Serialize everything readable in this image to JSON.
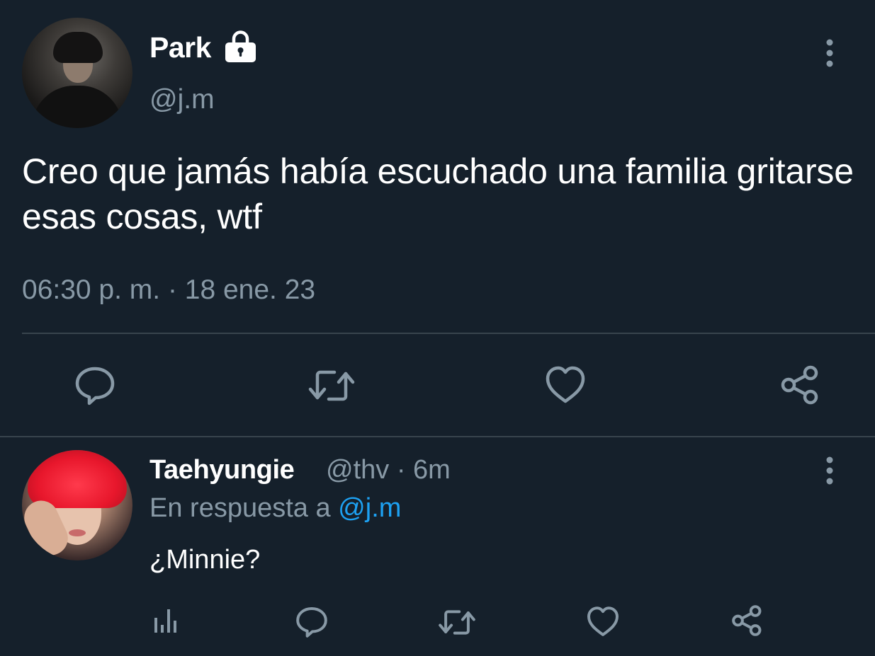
{
  "main_tweet": {
    "display_name": "Park",
    "handle": "@j.m",
    "text": "Creo que jamás había escuchado una familia gritarse esas cosas, wtf",
    "timestamp": "06:30 p. m. · 18 ene. 23",
    "icons": {
      "lock": "lock-icon",
      "more": "more-vertical-icon",
      "reply": "comment-icon",
      "retweet": "retweet-icon",
      "like": "heart-icon",
      "share": "share-icon"
    }
  },
  "reply": {
    "display_name": "Taehyungie",
    "handle_time": "@thv · 6m",
    "replying_prefix": "En respuesta a ",
    "replying_mention": "@j.m",
    "text": "¿Minnie?",
    "icons": {
      "analytics": "analytics-icon",
      "reply": "comment-icon",
      "retweet": "retweet-icon",
      "like": "heart-icon",
      "share": "share-icon",
      "more": "more-vertical-icon"
    }
  },
  "colors": {
    "background": "#15202b",
    "secondary_text": "#8899a6",
    "divider": "#38444d",
    "mention": "#1da1f2",
    "icon": "#8899a6"
  }
}
